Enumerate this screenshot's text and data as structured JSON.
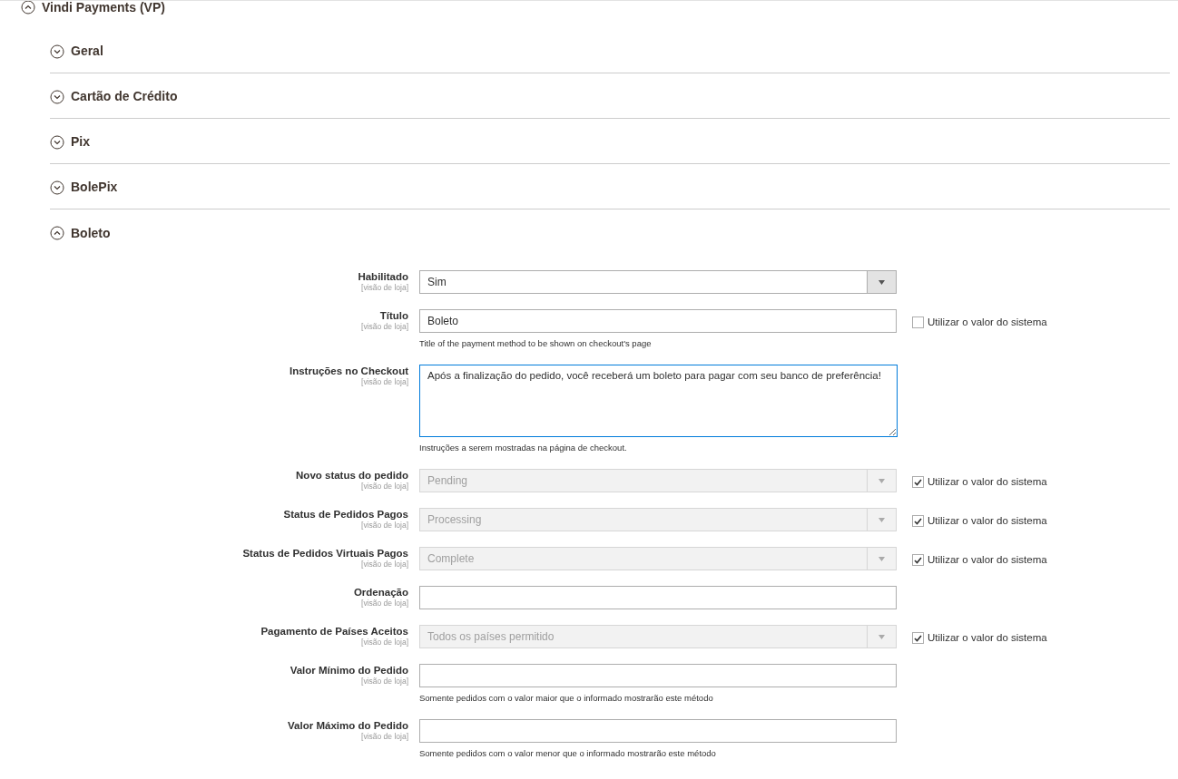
{
  "group": {
    "title": "Vindi Payments (VP)",
    "expanded": true
  },
  "sections": [
    {
      "title": "Geral",
      "expanded": false
    },
    {
      "title": "Cartão de Crédito",
      "expanded": false
    },
    {
      "title": "Pix",
      "expanded": false
    },
    {
      "title": "BolePix",
      "expanded": false
    },
    {
      "title": "Boleto",
      "expanded": true
    }
  ],
  "fields": [
    {
      "kind": "select",
      "label": "Habilitado",
      "scope": "[visão de loja]",
      "value": "Sim",
      "disabled": false
    },
    {
      "kind": "text",
      "label": "Título",
      "scope": "[visão de loja]",
      "value": "Boleto",
      "disabled": false,
      "hint": "Title of the payment method to be shown on checkout's page",
      "use_system": {
        "label": "Utilizar o valor do sistema",
        "checked": false
      }
    },
    {
      "kind": "textarea",
      "label": "Instruções no Checkout",
      "scope": "[visão de loja]",
      "value": "Após a finalização do pedido, você receberá um boleto para pagar com seu banco de preferência!",
      "disabled": false,
      "focused": true,
      "hint": "Instruções a serem mostradas na página de checkout."
    },
    {
      "kind": "select",
      "label": "Novo status do pedido",
      "scope": "[visão de loja]",
      "value": "Pending",
      "disabled": true,
      "use_system": {
        "label": "Utilizar o valor do sistema",
        "checked": true
      }
    },
    {
      "kind": "select",
      "label": "Status de Pedidos Pagos",
      "scope": "[visão de loja]",
      "value": "Processing",
      "disabled": true,
      "use_system": {
        "label": "Utilizar o valor do sistema",
        "checked": true
      }
    },
    {
      "kind": "select",
      "label": "Status de Pedidos Virtuais Pagos",
      "scope": "[visão de loja]",
      "value": "Complete",
      "disabled": true,
      "use_system": {
        "label": "Utilizar o valor do sistema",
        "checked": true
      }
    },
    {
      "kind": "text",
      "label": "Ordenação",
      "scope": "[visão de loja]",
      "disabled": false
    },
    {
      "kind": "select",
      "label": "Pagamento de Países Aceitos",
      "scope": "[visão de loja]",
      "value": "Todos os países permitido",
      "disabled": true,
      "use_system": {
        "label": "Utilizar o valor do sistema",
        "checked": true
      }
    },
    {
      "kind": "text",
      "label": "Valor Mínimo do Pedido",
      "scope": "[visão de loja]",
      "disabled": false,
      "hint": "Somente pedidos com o valor maior que o informado mostrarão este método"
    },
    {
      "kind": "text",
      "label": "Valor Máximo do Pedido",
      "scope": "[visão de loja]",
      "disabled": false,
      "hint": "Somente pedidos com o valor menor que o informado mostrarão este método"
    }
  ]
}
